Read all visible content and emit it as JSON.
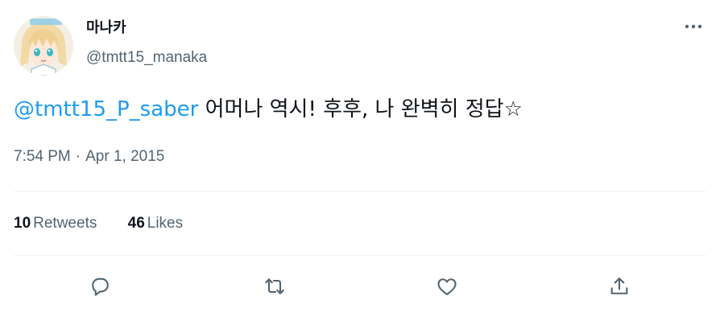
{
  "tweet": {
    "author": {
      "display_name": "마나카",
      "handle": "@tmtt15_manaka",
      "avatar_icon": "avatar-image"
    },
    "text": {
      "mention": "@tmtt15_P_saber",
      "body": " 어머나 역시! 후후, 나 완벽히 정답☆"
    },
    "time": "7:54 PM",
    "separator": "·",
    "date": "Apr 1, 2015",
    "stats": {
      "retweets_count": "10",
      "retweets_label": "Retweets",
      "likes_count": "46",
      "likes_label": "Likes"
    },
    "actions": [
      "reply-icon",
      "retweet-icon",
      "like-icon",
      "share-icon"
    ],
    "more_icon": "more-options-icon"
  },
  "colors": {
    "accent": "#1d9bf0",
    "text_primary": "#0f1419",
    "text_secondary": "#536471",
    "divider": "#eff3f4"
  }
}
